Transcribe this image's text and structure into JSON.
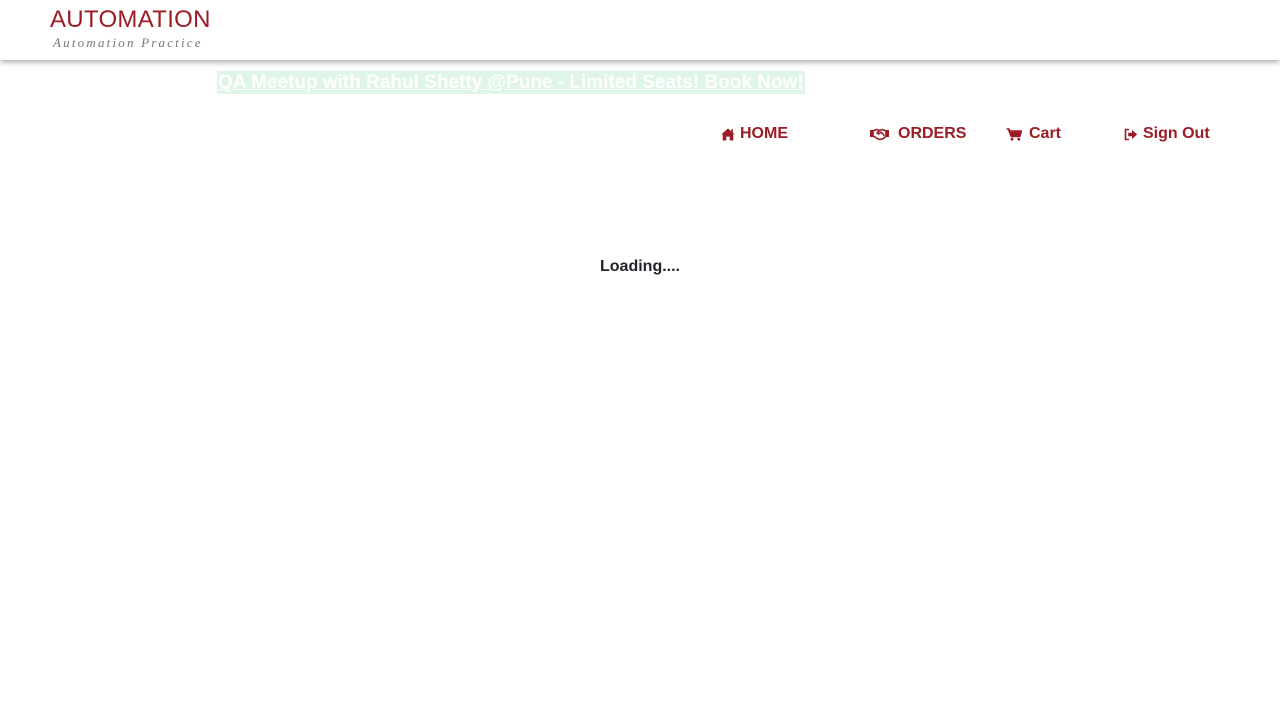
{
  "logo": {
    "title": "AUTOMATION",
    "subtitle": "Automation Practice"
  },
  "promo": {
    "text": "QA Meetup with Rahul Shetty @Pune - Limited Seats! Book Now!"
  },
  "nav": {
    "home": {
      "label": "HOME",
      "icon": "home-icon"
    },
    "orders": {
      "label": "ORDERS",
      "icon": "handshake-icon"
    },
    "cart": {
      "label": "Cart",
      "icon": "cart-icon"
    },
    "signout": {
      "label": "Sign Out",
      "icon": "sign-out-icon"
    }
  },
  "main": {
    "loading_text": "Loading...."
  },
  "colors": {
    "brand": "#9b1c24",
    "promo_background": "#dff5e8",
    "text_dark": "#212529"
  }
}
